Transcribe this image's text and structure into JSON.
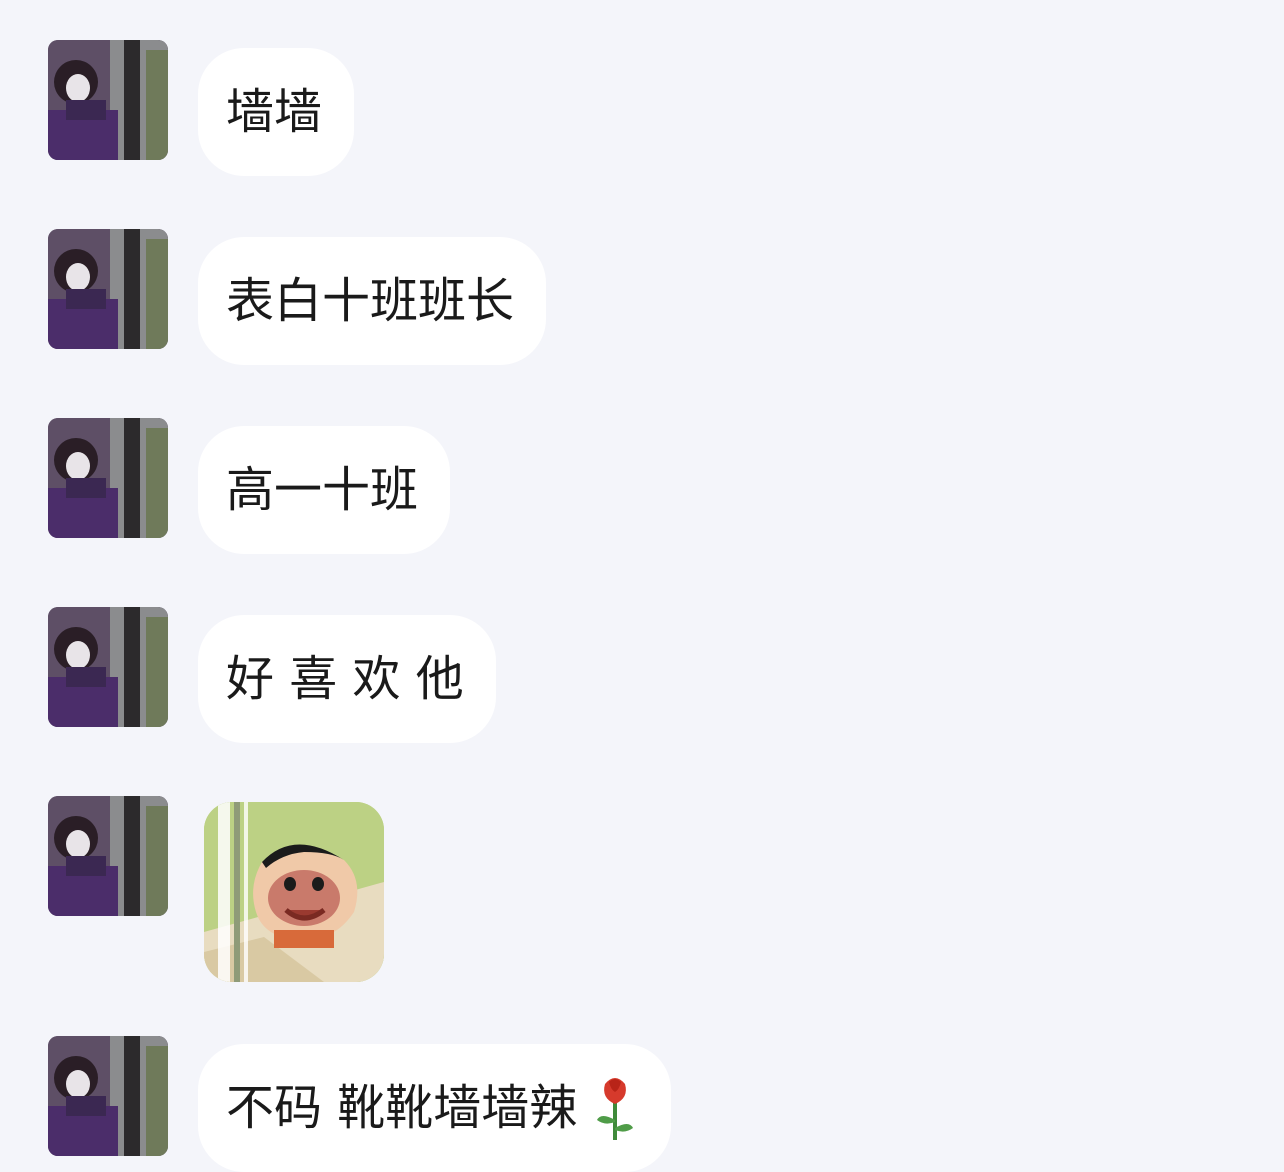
{
  "messages": [
    {
      "type": "text",
      "text": "墙墙"
    },
    {
      "type": "text",
      "text": "表白十班班长"
    },
    {
      "type": "text",
      "text": "高一十班"
    },
    {
      "type": "text",
      "text": "好 喜 欢 他"
    },
    {
      "type": "sticker",
      "sticker": "crayon-shin-chan-peeking-sticker"
    },
    {
      "type": "text",
      "text": "不码 靴靴墙墙辣",
      "emoji": "rose-emoji"
    }
  ],
  "colors": {
    "background": "#f4f5fa",
    "bubble": "#ffffff",
    "text": "#1a1a1a"
  }
}
